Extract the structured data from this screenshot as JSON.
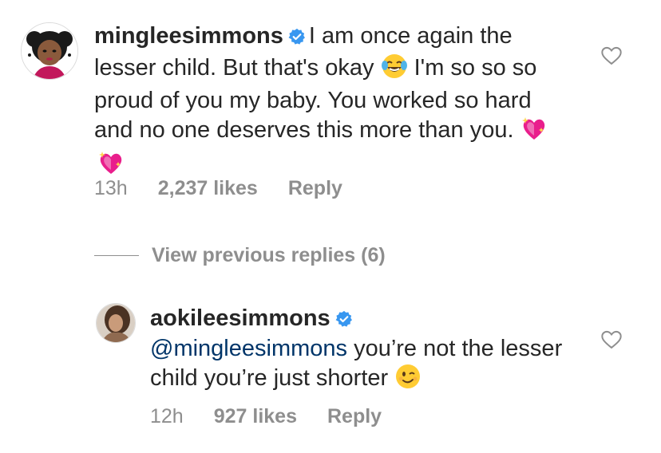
{
  "comment": {
    "username": "mingleesimmons",
    "text_parts": [
      "I am once again the lesser child. But that's okay",
      "I'm so so so proud of you my baby. You worked so hard and no one deserves this more than you."
    ],
    "time": "13h",
    "likes": "2,237 likes",
    "reply": "Reply",
    "icons": [
      "verified-badge-icon",
      "laughing-tears-emoji",
      "sparkling-heart-emoji",
      "heart-outline-icon"
    ]
  },
  "view_previous": {
    "label": "View previous replies (6)"
  },
  "reply": {
    "username": "aokileesimmons",
    "mention": "@mingleesimmons",
    "text": "you’re not the lesser child you’re just shorter",
    "time": "12h",
    "likes": "927 likes",
    "reply": "Reply",
    "icons": [
      "verified-badge-icon",
      "winking-face-emoji",
      "heart-outline-icon"
    ]
  },
  "colors": {
    "verified": "#3897f0",
    "meta": "#8e8e8e",
    "mention": "#003569",
    "text": "#262626"
  }
}
